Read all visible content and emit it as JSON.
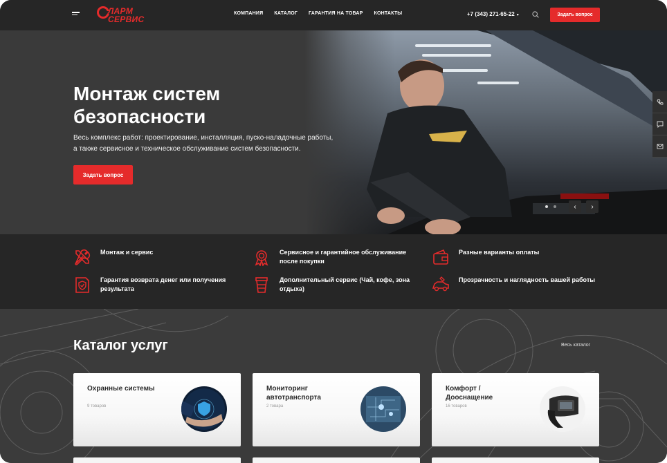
{
  "brand": {
    "name_line1": "ЛАРМ",
    "name_line2": "СЕРВИС",
    "accent_color": "#e52b2b"
  },
  "header": {
    "nav": [
      "КОМПАНИЯ",
      "КАТАЛОГ",
      "ГАРАНТИЯ НА ТОВАР",
      "КОНТАКТЫ"
    ],
    "phone": "+7 (343) 271-65-22",
    "cta": "Задать вопрос"
  },
  "hero": {
    "title": "Монтаж систем безопасности",
    "text": "Весь комплекс работ: проектирование, инсталляция, пуско-наладочные работы, а также сервисное и техническое обслуживание систем безопасности.",
    "cta": "Задать вопрос",
    "slides_total": 2,
    "slides_current": 1
  },
  "features": [
    {
      "icon": "tools-icon",
      "text": "Монтаж и сервис"
    },
    {
      "icon": "award-icon",
      "text": "Сервисное и гарантийное обслуживание после покупки"
    },
    {
      "icon": "wallet-icon",
      "text": "Разные варианты оплаты"
    },
    {
      "icon": "shield-document-icon",
      "text": "Гарантия возврата денег или получения результата"
    },
    {
      "icon": "coffee-cup-icon",
      "text": "Дополнительный сервис (Чай, кофе, зона отдыха)"
    },
    {
      "icon": "car-service-icon",
      "text": "Прозрачность и наглядность вашей работы"
    }
  ],
  "catalog": {
    "title": "Каталог услуг",
    "all_link": "Весь каталог",
    "cards": [
      {
        "title": "Охранные системы",
        "count": "9 товаров"
      },
      {
        "title": "Мониторинг автотранспорта",
        "count": "2 товара"
      },
      {
        "title": "Комфорт / Дооснащение",
        "count": "16 товаров"
      }
    ]
  }
}
